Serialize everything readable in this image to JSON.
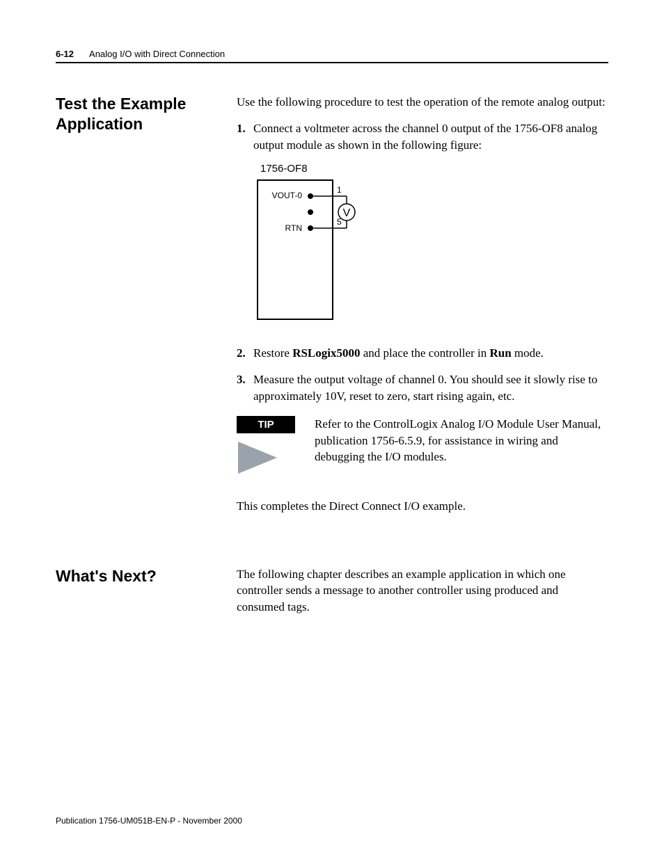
{
  "header": {
    "page_num": "6-12",
    "chapter": "Analog I/O with Direct Connection"
  },
  "section1": {
    "heading": "Test the Example Application",
    "intro": "Use the following procedure to test the operation of the remote analog output:",
    "step1_num": "1.",
    "step1_text": "Connect a voltmeter across the channel 0 output of the 1756-OF8 analog output module as shown in the following figure:",
    "step2_num": "2.",
    "step2_pre": "Restore ",
    "step2_b1": "RSLogix5000",
    "step2_mid": " and place the controller in ",
    "step2_b2": "Run",
    "step2_post": " mode.",
    "step3_num": "3.",
    "step3_text": "Measure the output voltage of channel 0. You should see it slowly rise to approximately 10V, reset to zero, start rising again, etc.",
    "closing": "This completes the Direct Connect I/O example."
  },
  "figure": {
    "title": "1756-OF8",
    "label_vout": "VOUT-0",
    "label_rtn": "RTN",
    "pin1": "1",
    "pin5": "5",
    "meter": "V"
  },
  "tip": {
    "label": "TIP",
    "text": "Refer to the ControlLogix Analog I/O Module User Manual, publication 1756-6.5.9, for assistance in wiring and debugging the I/O modules."
  },
  "section2": {
    "heading": "What's Next?",
    "text": "The following chapter describes an example application in which one controller sends a message to another controller using produced and consumed tags."
  },
  "footer": "Publication 1756-UM051B-EN-P - November 2000"
}
